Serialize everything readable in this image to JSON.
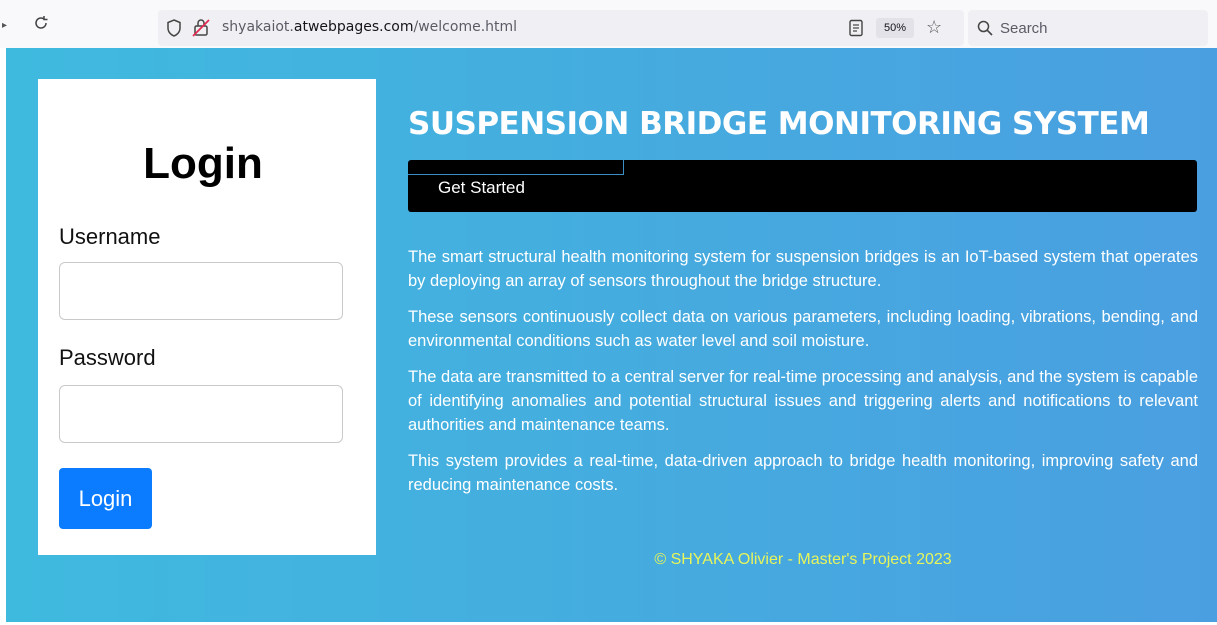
{
  "browser": {
    "url_prefix": "shyakaiot.",
    "url_domain": "atwebpages.com",
    "url_path": "/welcome.html",
    "zoom": "50%",
    "search_placeholder": "Search"
  },
  "login": {
    "title": "Login",
    "username_label": "Username",
    "password_label": "Password",
    "button_label": "Login"
  },
  "main": {
    "headline": "SUSPENSION BRIDGE MONITORING SYSTEM",
    "get_started": "Get Started",
    "paragraphs": [
      "The smart structural health monitoring system for suspension bridges is an IoT-based system that operates by deploying an array of sensors throughout the bridge structure.",
      "These sensors continuously collect data on various parameters, including loading, vibrations, bending, and environmental conditions such as water level and soil moisture.",
      "The data are transmitted to a central server for real-time processing and analysis, and the system is capable of identifying anomalies and potential structural issues and triggering alerts and notifications to relevant authorities and maintenance teams.",
      "This system provides a real-time, data-driven approach to bridge health monitoring, improving safety and reducing maintenance costs."
    ],
    "footer": "© SHYAKA Olivier - Master's Project 2023"
  },
  "colors": {
    "footer_text": "#e8f55a",
    "login_button": "#0b7cff"
  }
}
